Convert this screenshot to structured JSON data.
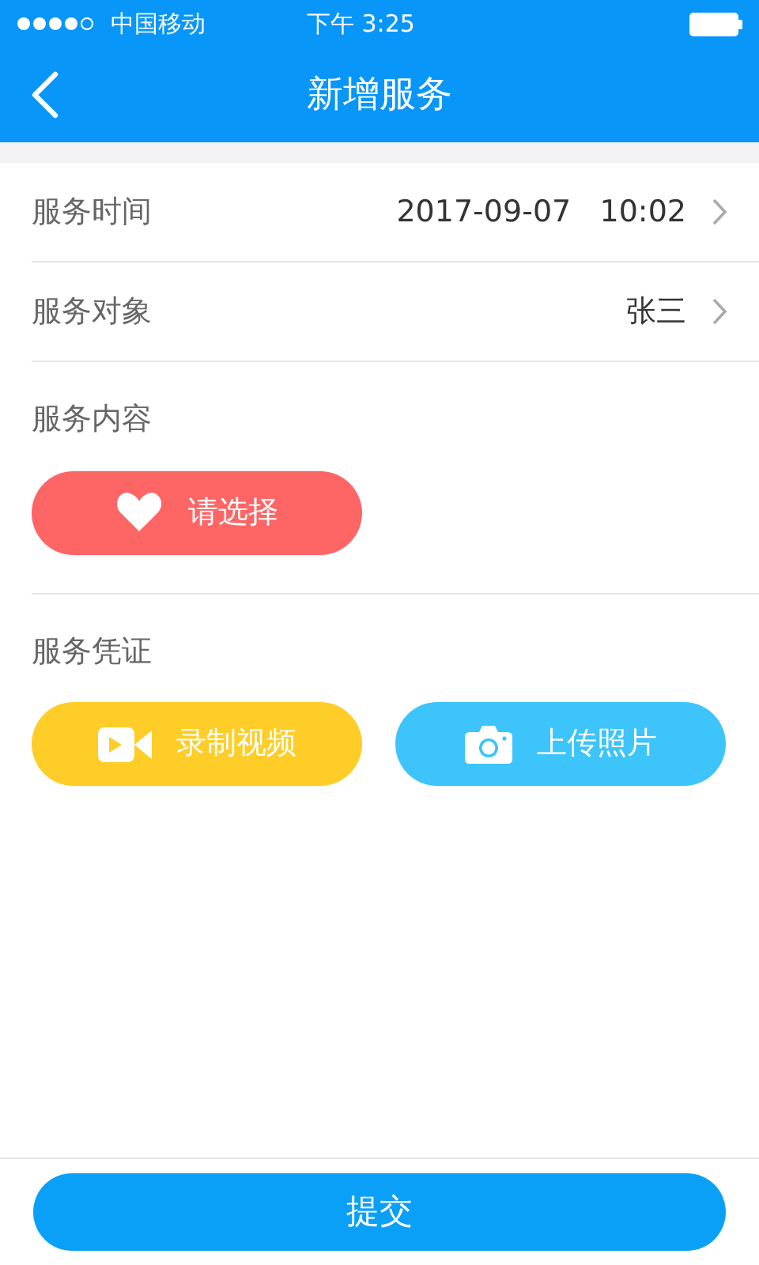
{
  "status_bar": {
    "carrier": "中国移动",
    "time": "下午 3:25"
  },
  "nav": {
    "title": "新增服务"
  },
  "rows": [
    {
      "label": "服务时间",
      "value": "2017-09-07   10:02"
    },
    {
      "label": "服务对象",
      "value": "张三"
    }
  ],
  "sections": [
    {
      "title": "服务内容",
      "buttons": [
        {
          "label": "请选择",
          "kind": "heart",
          "color": "#fe6565"
        }
      ]
    },
    {
      "title": "服务凭证",
      "buttons": [
        {
          "label": "录制视频",
          "kind": "video",
          "color": "#fecd27"
        },
        {
          "label": "上传照片",
          "kind": "camera",
          "color": "#3cc4fb"
        }
      ]
    }
  ],
  "submit": "提交"
}
